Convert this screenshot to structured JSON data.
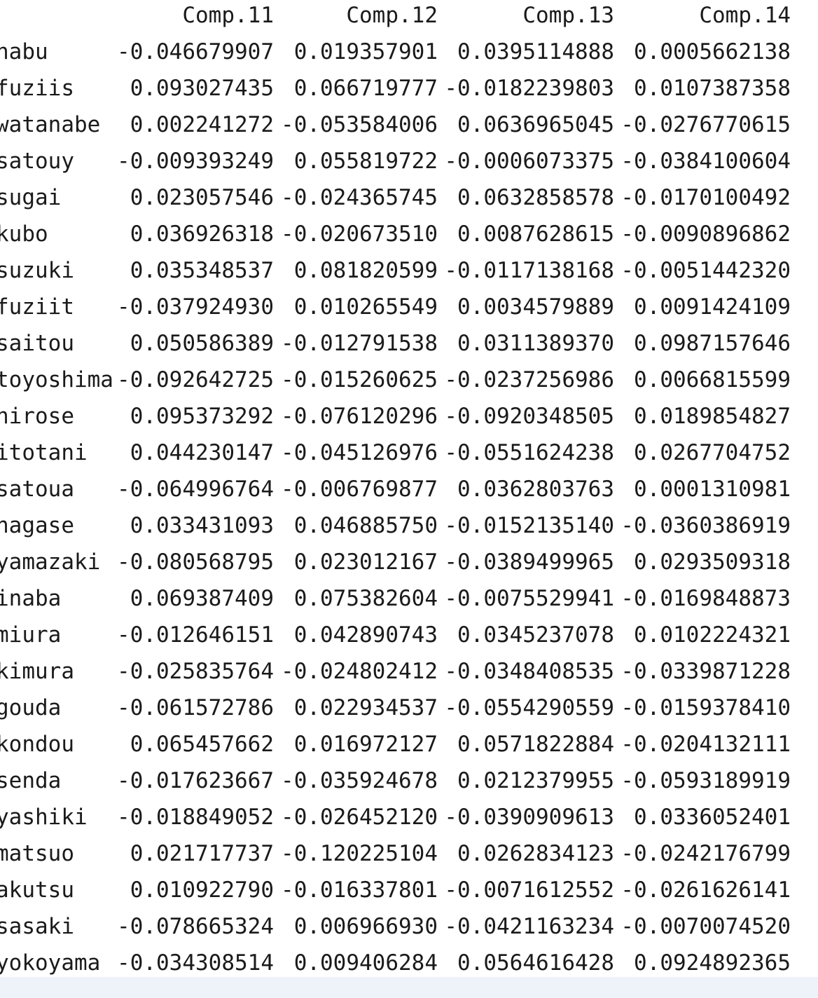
{
  "table": {
    "columns": [
      "Comp.11",
      "Comp.12",
      "Comp.13",
      "Comp.14"
    ],
    "rows": [
      {
        "name": "habu",
        "values": [
          "-0.046679907",
          "0.019357901",
          "0.0395114888",
          "0.0005662138"
        ]
      },
      {
        "name": "fuziis",
        "values": [
          "0.093027435",
          "0.066719777",
          "-0.0182239803",
          "0.0107387358"
        ]
      },
      {
        "name": "watanabe",
        "values": [
          "0.002241272",
          "-0.053584006",
          "0.0636965045",
          "-0.0276770615"
        ]
      },
      {
        "name": "satouy",
        "values": [
          "-0.009393249",
          "0.055819722",
          "-0.0006073375",
          "-0.0384100604"
        ]
      },
      {
        "name": "sugai",
        "values": [
          "0.023057546",
          "-0.024365745",
          "0.0632858578",
          "-0.0170100492"
        ]
      },
      {
        "name": "kubo",
        "values": [
          "0.036926318",
          "-0.020673510",
          "0.0087628615",
          "-0.0090896862"
        ]
      },
      {
        "name": "suzuki",
        "values": [
          "0.035348537",
          "0.081820599",
          "-0.0117138168",
          "-0.0051442320"
        ]
      },
      {
        "name": "fuziit",
        "values": [
          "-0.037924930",
          "0.010265549",
          "0.0034579889",
          "0.0091424109"
        ]
      },
      {
        "name": "saitou",
        "values": [
          "0.050586389",
          "-0.012791538",
          "0.0311389370",
          "0.0987157646"
        ]
      },
      {
        "name": "toyoshima",
        "values": [
          "-0.092642725",
          "-0.015260625",
          "-0.0237256986",
          "0.0066815599"
        ]
      },
      {
        "name": "hirose",
        "values": [
          "0.095373292",
          "-0.076120296",
          "-0.0920348505",
          "0.0189854827"
        ]
      },
      {
        "name": "itotani",
        "values": [
          "0.044230147",
          "-0.045126976",
          "-0.0551624238",
          "0.0267704752"
        ]
      },
      {
        "name": "satoua",
        "values": [
          "-0.064996764",
          "-0.006769877",
          "0.0362803763",
          "0.0001310981"
        ]
      },
      {
        "name": "nagase",
        "values": [
          "0.033431093",
          "0.046885750",
          "-0.0152135140",
          "-0.0360386919"
        ]
      },
      {
        "name": "yamazaki",
        "values": [
          "-0.080568795",
          "0.023012167",
          "-0.0389499965",
          "0.0293509318"
        ]
      },
      {
        "name": "inaba",
        "values": [
          "0.069387409",
          "0.075382604",
          "-0.0075529941",
          "-0.0169848873"
        ]
      },
      {
        "name": "miura",
        "values": [
          "-0.012646151",
          "0.042890743",
          "0.0345237078",
          "0.0102224321"
        ]
      },
      {
        "name": "kimura",
        "values": [
          "-0.025835764",
          "-0.024802412",
          "-0.0348408535",
          "-0.0339871228"
        ]
      },
      {
        "name": "gouda",
        "values": [
          "-0.061572786",
          "0.022934537",
          "-0.0554290559",
          "-0.0159378410"
        ]
      },
      {
        "name": "kondou",
        "values": [
          "0.065457662",
          "0.016972127",
          "0.0571822884",
          "-0.0204132111"
        ]
      },
      {
        "name": "senda",
        "values": [
          "-0.017623667",
          "-0.035924678",
          "0.0212379955",
          "-0.0593189919"
        ]
      },
      {
        "name": "yashiki",
        "values": [
          "-0.018849052",
          "-0.026452120",
          "-0.0390909613",
          "0.0336052401"
        ]
      },
      {
        "name": "matsuo",
        "values": [
          "0.021717737",
          "-0.120225104",
          "0.0262834123",
          "-0.0242176799"
        ]
      },
      {
        "name": "akutsu",
        "values": [
          "0.010922790",
          "-0.016337801",
          "-0.0071612552",
          "-0.0261626141"
        ]
      },
      {
        "name": "sasaki",
        "values": [
          "-0.078665324",
          "0.006966930",
          "-0.0421163234",
          "-0.0070074520"
        ]
      },
      {
        "name": "yokoyama",
        "values": [
          "-0.034308514",
          "0.009406284",
          "0.0564616428",
          "0.0924892365"
        ]
      }
    ]
  }
}
